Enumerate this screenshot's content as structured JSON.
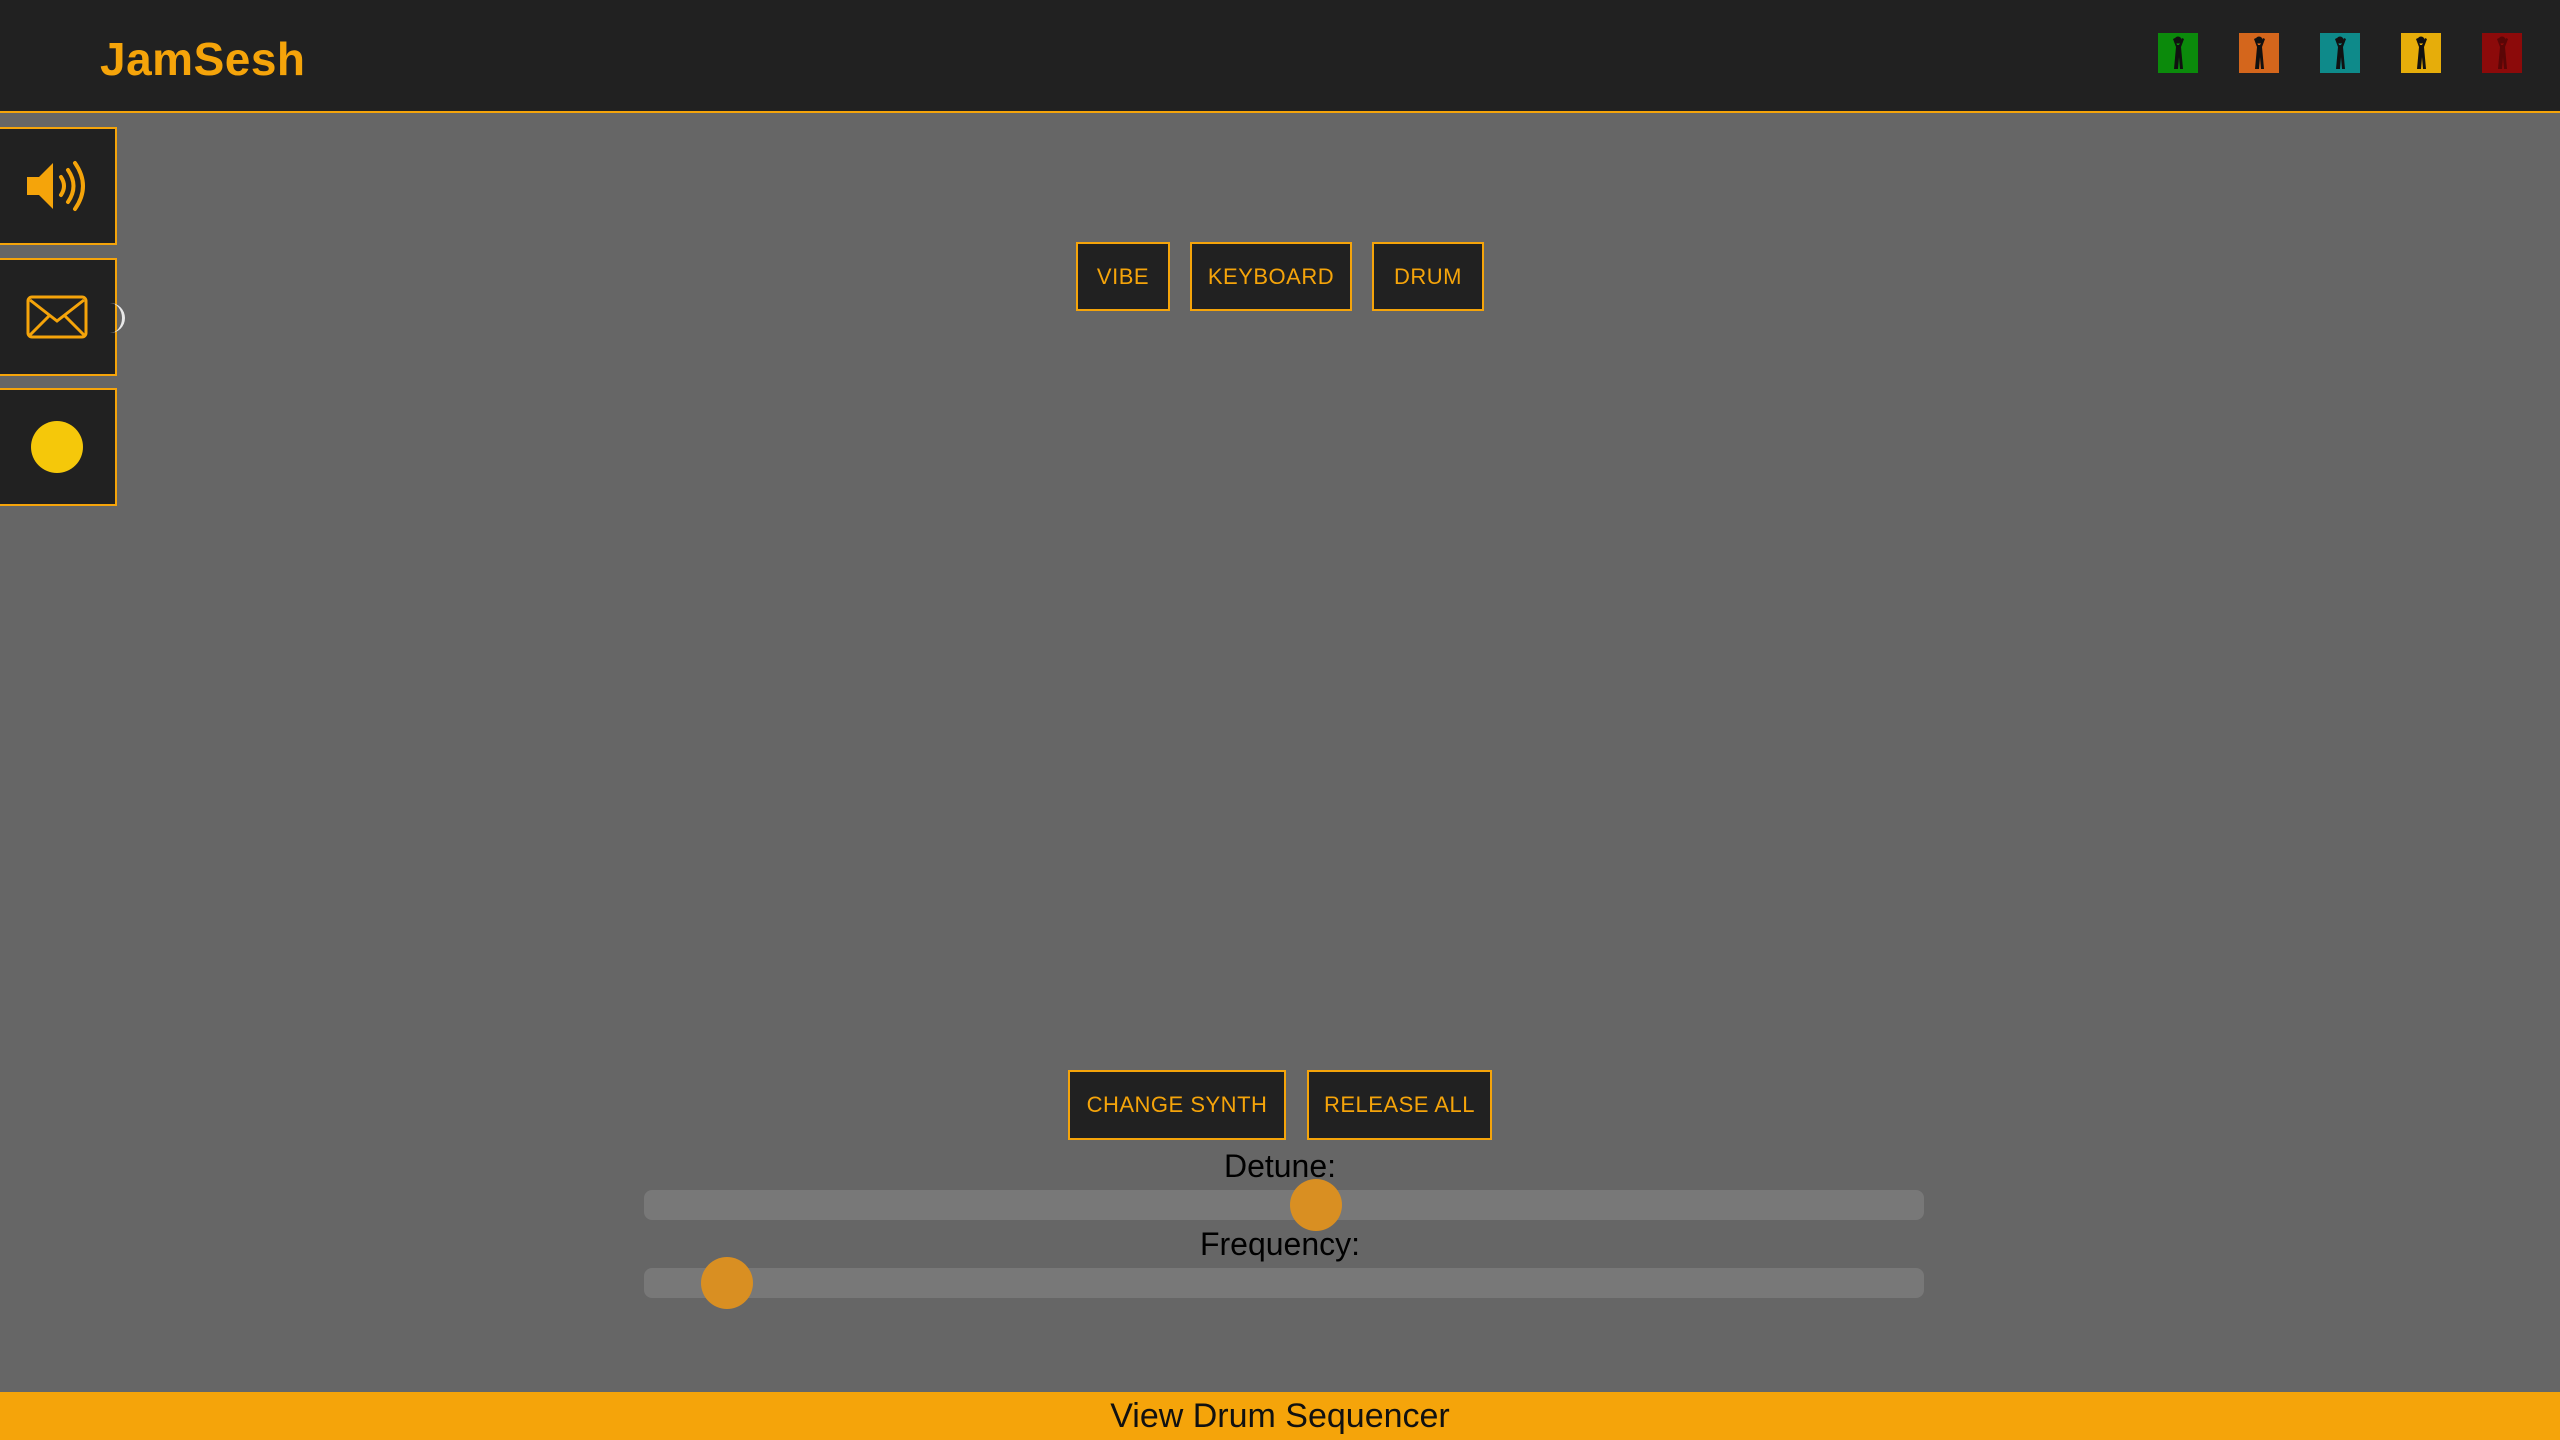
{
  "app": {
    "brand": "JamSesh"
  },
  "users": [
    {
      "color": "#0b8a0b",
      "icon": "person-icon"
    },
    {
      "color": "#d4661c",
      "icon": "person-icon"
    },
    {
      "color": "#0e8a8a",
      "icon": "person-icon"
    },
    {
      "color": "#e6ad0a",
      "icon": "person-icon"
    },
    {
      "color": "#8c0a0a",
      "icon": "person-icon"
    }
  ],
  "sidebar": {
    "items": [
      {
        "icon": "speaker-icon"
      },
      {
        "icon": "envelope-icon"
      },
      {
        "icon": "record-dot-icon"
      }
    ]
  },
  "instruments": {
    "vibe": "VIBE",
    "keyboard": "KEYBOARD",
    "drum": "DRUM"
  },
  "controls": {
    "change_synth": "CHANGE SYNTH",
    "release_all": "RELEASE ALL",
    "detune_label": "Detune:",
    "detune_value": 0.525,
    "frequency_label": "Frequency:",
    "frequency_value": 0.065
  },
  "footer": {
    "label": "View Drum Sequencer"
  },
  "colors": {
    "accent": "#f5a40a",
    "panel": "#212121",
    "background": "#666666",
    "thumb": "#d98f22"
  }
}
